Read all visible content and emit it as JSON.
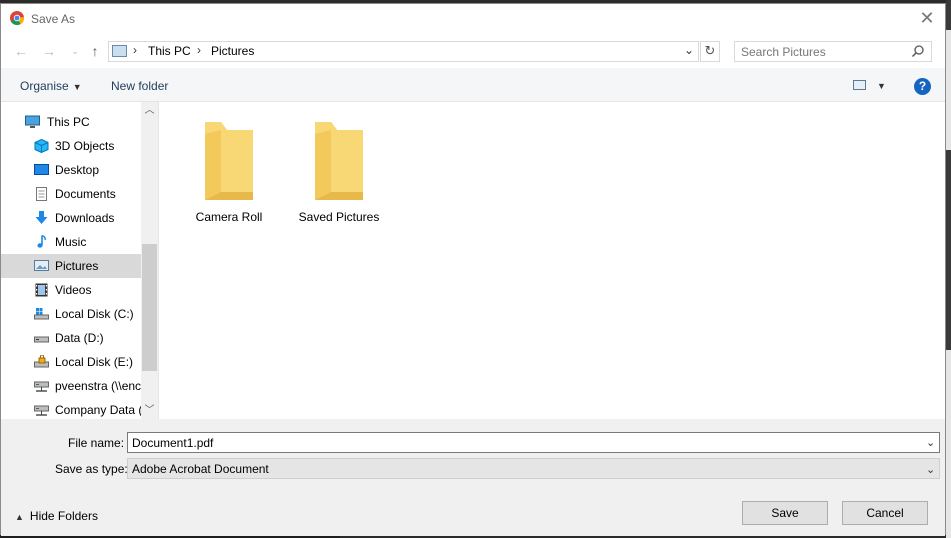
{
  "window": {
    "title": "Save As"
  },
  "address": {
    "crumbs": [
      "This PC",
      "Pictures"
    ]
  },
  "search": {
    "placeholder": "Search Pictures"
  },
  "toolbar": {
    "organise": "Organise",
    "new_folder": "New folder",
    "help": "?"
  },
  "nav": {
    "items": [
      {
        "label": "This PC",
        "icon": "pc-icon"
      },
      {
        "label": "3D Objects",
        "icon": "cube-icon"
      },
      {
        "label": "Desktop",
        "icon": "desktop-icon"
      },
      {
        "label": "Documents",
        "icon": "document-icon"
      },
      {
        "label": "Downloads",
        "icon": "download-arrow-icon"
      },
      {
        "label": "Music",
        "icon": "music-note-icon"
      },
      {
        "label": "Pictures",
        "icon": "pictures-icon",
        "selected": true
      },
      {
        "label": "Videos",
        "icon": "film-icon"
      },
      {
        "label": "Local Disk (C:)",
        "icon": "system-drive-icon"
      },
      {
        "label": "Data (D:)",
        "icon": "drive-icon"
      },
      {
        "label": "Local Disk (E:)",
        "icon": "locked-drive-icon"
      },
      {
        "label": "pveenstra (\\\\enc",
        "icon": "network-drive-icon"
      },
      {
        "label": "Company Data (",
        "icon": "network-drive-icon"
      }
    ]
  },
  "folders": [
    {
      "name": "Camera Roll"
    },
    {
      "name": "Saved Pictures"
    }
  ],
  "form": {
    "file_name_label": "File name:",
    "file_name_value": "Document1.pdf",
    "save_type_label": "Save as type:",
    "save_type_value": "Adobe Acrobat Document"
  },
  "footer": {
    "hide_folders": "Hide Folders",
    "save": "Save",
    "cancel": "Cancel"
  },
  "colors": {
    "accent": "#1565c0",
    "selected": "#d9d9d9",
    "folder": "#f8d775"
  }
}
